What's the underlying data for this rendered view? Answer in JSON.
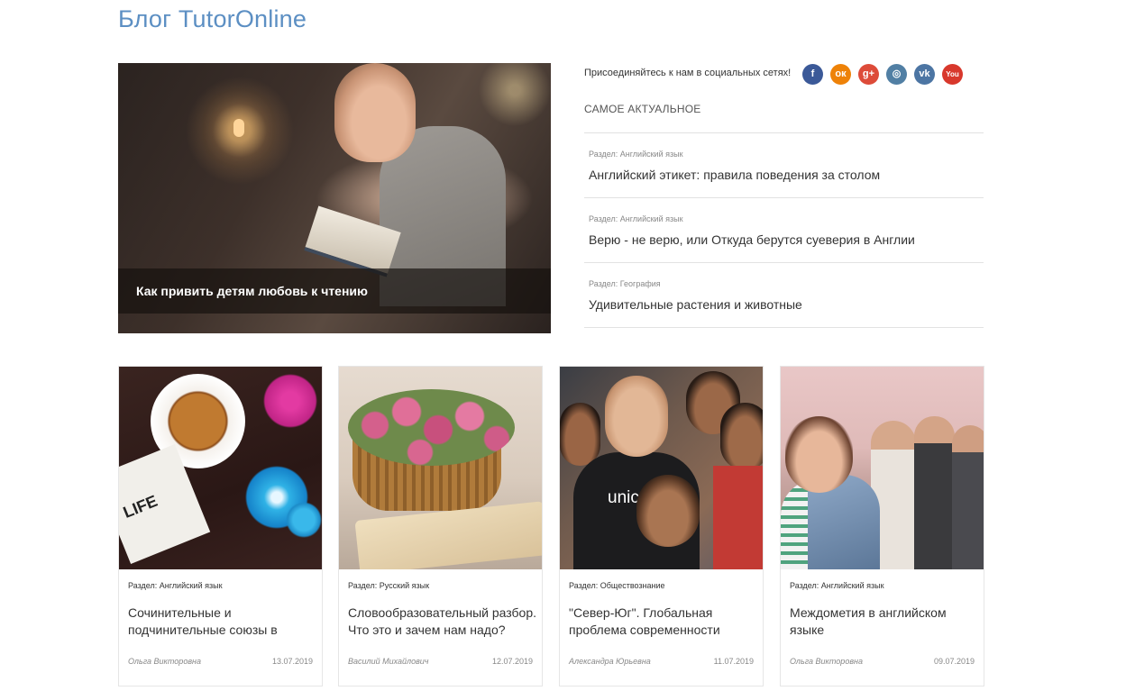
{
  "blog_title": "Блог TutorOnline",
  "hero": {
    "title": "Как привить детям любовь к чтению"
  },
  "social": {
    "join_text": "Присоединяйтесь к нам в социальных сетях!",
    "icons": [
      {
        "name": "facebook-icon",
        "glyph": "f",
        "color": "#3b5998"
      },
      {
        "name": "odnoklassniki-icon",
        "glyph": "ок",
        "color": "#ee8208"
      },
      {
        "name": "google-plus-icon",
        "glyph": "g+",
        "color": "#dd4b39"
      },
      {
        "name": "instagram-icon",
        "glyph": "◎",
        "color": "#517fa4"
      },
      {
        "name": "vk-icon",
        "glyph": "vk",
        "color": "#4c75a3"
      },
      {
        "name": "youtube-icon",
        "glyph": "You",
        "color": "#d8382c"
      }
    ]
  },
  "top_news": {
    "heading": "САМОЕ АКТУАЛЬНОЕ",
    "items": [
      {
        "section": "Раздел: Английский язык",
        "title": "Английский этикет: правила поведения за столом"
      },
      {
        "section": "Раздел: Английский язык",
        "title": "Верю - не верю, или Откуда берутся суеверия в Англии"
      },
      {
        "section": "Раздел: География",
        "title": "Удивительные растения и животные"
      }
    ]
  },
  "cards": [
    {
      "section": "Раздел: Английский язык",
      "title": "Сочинительные и подчинительные союзы в",
      "author": "Ольга Викторовна",
      "date": "13.07.2019"
    },
    {
      "section": "Раздел: Русский язык",
      "title": "Словообразовательный разбор. Что это и зачем нам надо?",
      "author": "Василий Михайлович",
      "date": "12.07.2019"
    },
    {
      "section": "Раздел: Обществознание",
      "title": "\"Север-Юг\". Глобальная проблема современности",
      "author": "Александра Юрьевна",
      "date": "11.07.2019"
    },
    {
      "section": "Раздел: Английский язык",
      "title": "Междометия в английском языке",
      "author": "Ольга Викторовна",
      "date": "09.07.2019"
    }
  ],
  "thumb_text": {
    "card1_note": "LIFE",
    "card3_shirt": "unic"
  }
}
